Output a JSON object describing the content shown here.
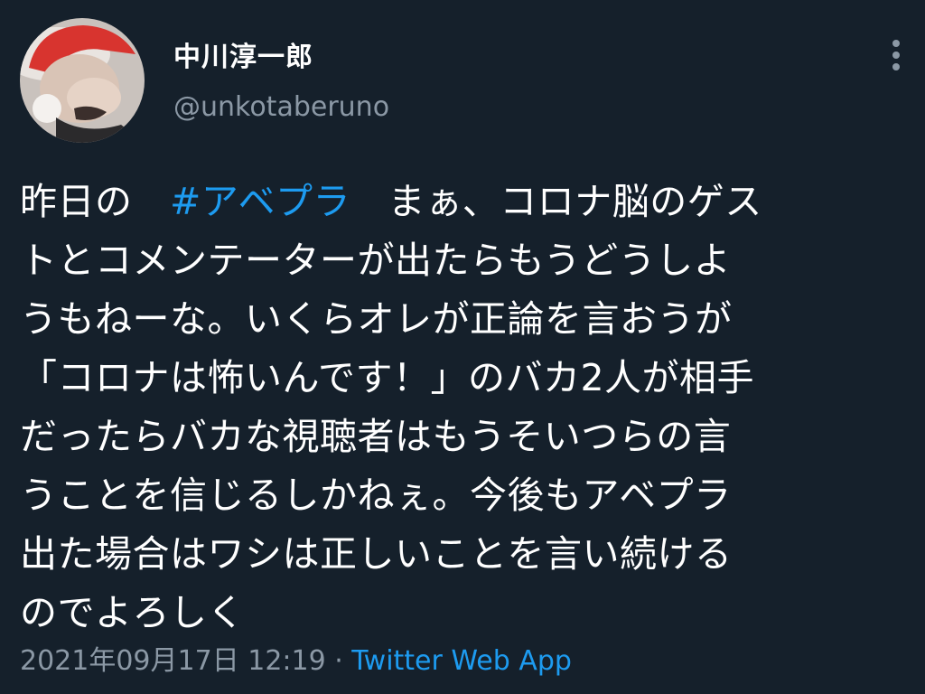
{
  "user": {
    "display_name": "中川淳一郎",
    "handle": "@unkotaberuno"
  },
  "tweet": {
    "lines": [
      {
        "pre": "昨日の　",
        "hashtag": "#アベプラ",
        "post": "　まぁ、コロナ脳のゲス"
      },
      "トとコメンテーターが出たらもうどうしよ",
      "うもねーな。いくらオレが正論を言おうが",
      "「コロナは怖いんです！」のバカ2人が相手",
      "だったらバカな視聴者はもうそいつらの言",
      "うことを信じるしかねぇ。今後もアベプラ",
      "出た場合はワシは正しいことを言い続ける",
      "のでよろしく"
    ],
    "timestamp": "2021年09月17日 12:19",
    "separator": " · ",
    "source": "Twitter Web App"
  },
  "colors": {
    "background": "#15202b",
    "text": "#ffffff",
    "secondary": "#8b98a5",
    "accent": "#1d9bf0"
  },
  "icons": {
    "more": "more-vertical-icon"
  }
}
